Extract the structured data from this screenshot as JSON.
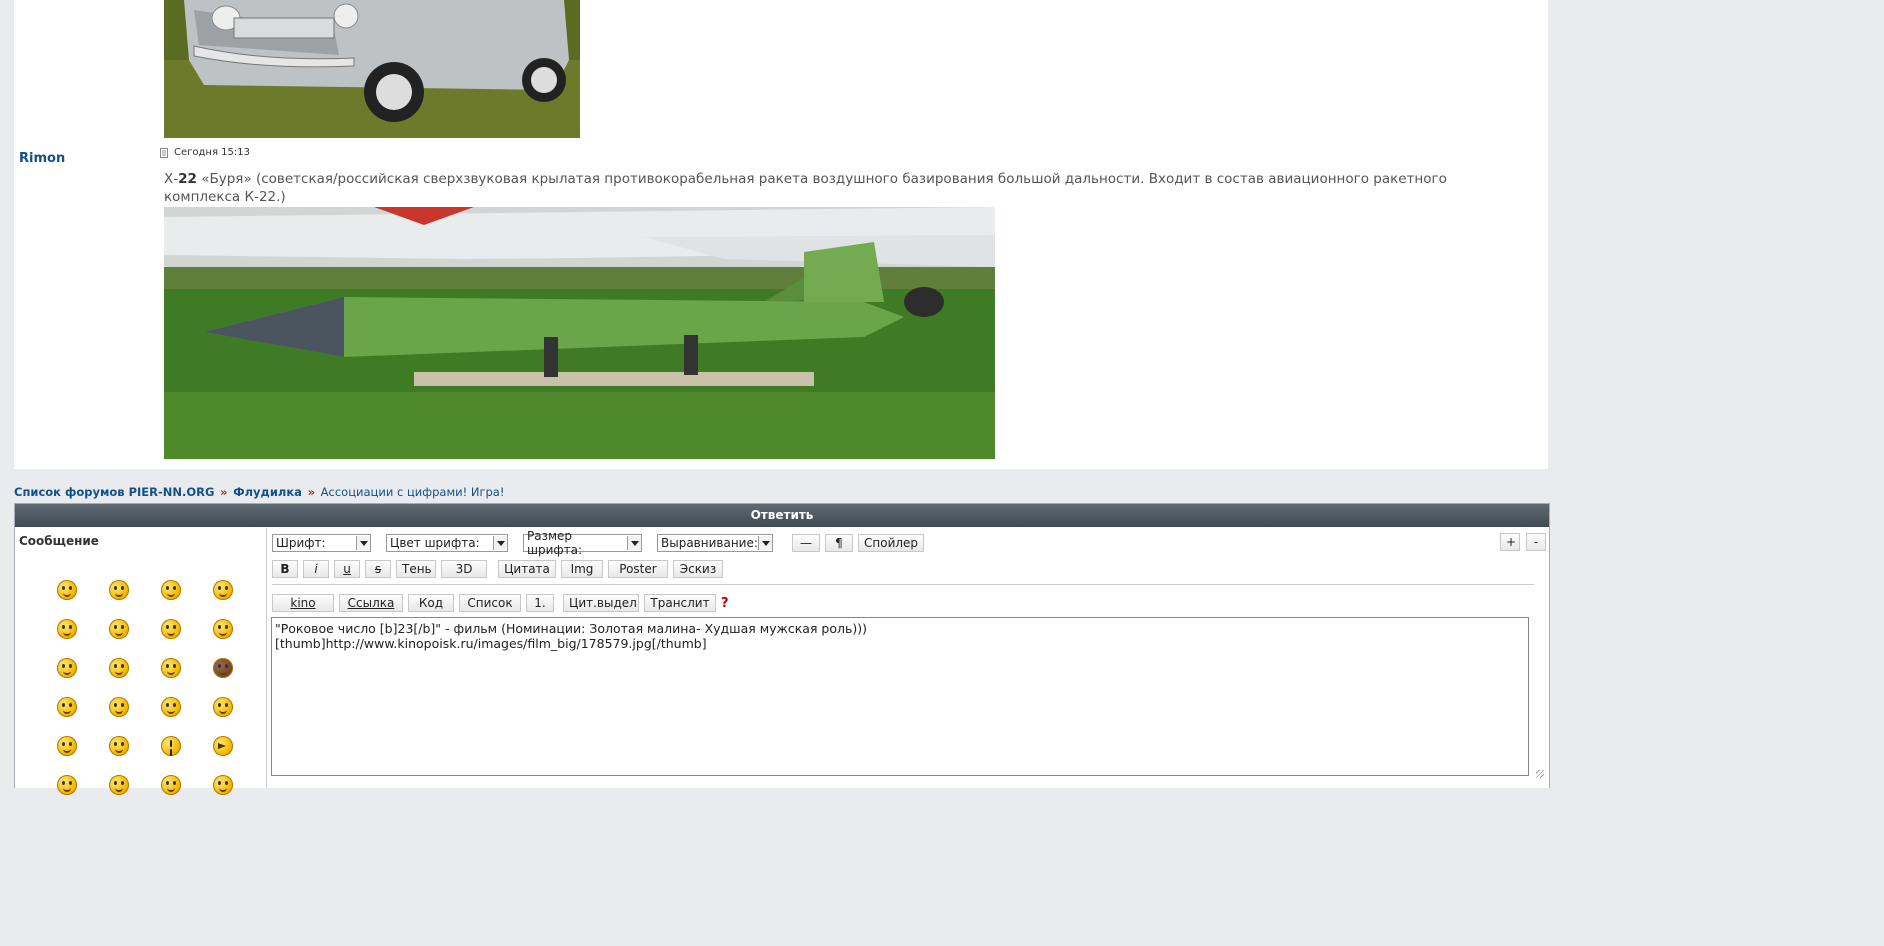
{
  "post": {
    "author": "Rimon",
    "date": "Сегодня 15:13",
    "text_prefix": "Х-",
    "text_bold": "22",
    "text_rest": " «Буря» (советская/российская сверхзвуковая крылатая противокорабельная ракета воздушного базирования большой дальности. Входит в состав авиационного ракетного комплекса К-22.)"
  },
  "breadcrumb": {
    "items": [
      "Список форумов PIER-NN.ORG",
      "Флудилка",
      "Ассоциации с цифрами! Игра!"
    ],
    "separator": "»"
  },
  "reply": {
    "header": "Ответить",
    "message_label": "Сообщение",
    "selects": [
      "Шрифт:",
      "Цвет шрифта:",
      "Размер шрифта:",
      "Выравнивание:"
    ],
    "row1_buttons": [
      "—",
      "¶",
      "Спойлер"
    ],
    "format_buttons": [
      "B",
      "i",
      "u",
      "s",
      "Тень",
      "3D",
      "Цитата",
      "Img",
      "Poster",
      "Эскиз"
    ],
    "row3_buttons": [
      "kino",
      "Ссылка",
      "Код",
      "Список",
      "1.",
      "Цит.выдел",
      "Транслит"
    ],
    "help": "?",
    "size_buttons": [
      "+",
      "-"
    ],
    "editor_text": "\"Роковое число [b]23[/b]\" - фильм (Номинации: Золотая малина- Худшая мужская роль)))\n[thumb]http://www.kinopoisk.ru/images/film_big/178579.jpg[/thumb]"
  },
  "smileys": [
    "smile",
    "laugh",
    "grin",
    "wave",
    "scream",
    "wink",
    "thumbs-up",
    "eek",
    "evil",
    "shy",
    "happy",
    "bomb",
    "sad",
    "smile",
    "clap",
    "panic",
    "cry",
    "smile",
    "exclaim",
    "arrow",
    "dance",
    "laugh",
    "smile",
    "smile"
  ]
}
